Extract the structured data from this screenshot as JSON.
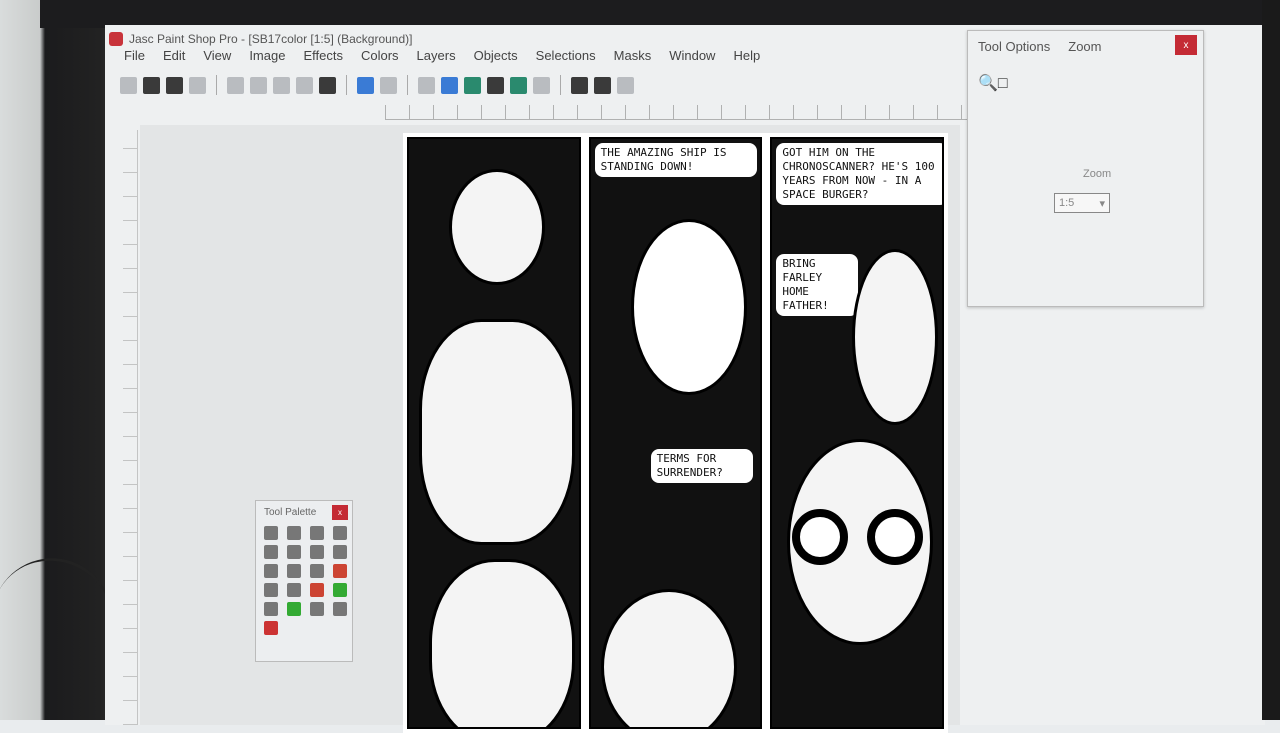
{
  "window": {
    "title": "Jasc Paint Shop Pro - [SB17color [1:5] (Background)]"
  },
  "menu": [
    "File",
    "Edit",
    "View",
    "Image",
    "Effects",
    "Colors",
    "Layers",
    "Objects",
    "Selections",
    "Masks",
    "Window",
    "Help"
  ],
  "tool_options": {
    "title": "Tool Options",
    "tool": "Zoom",
    "zoom_label": "Zoom",
    "zoom_value": "1:5",
    "close": "x"
  },
  "tool_palette": {
    "title": "Tool Palette",
    "close": "x"
  },
  "comic": {
    "panel2_bubble": "The amazing ship is standing down!",
    "panel2_bubble2": "Terms for surrender?",
    "panel3_bubble": "Got him on the chronoscanner? He's 100 years from now - in a space burger?",
    "panel3_bubble2": "Bring Farley home father!"
  }
}
